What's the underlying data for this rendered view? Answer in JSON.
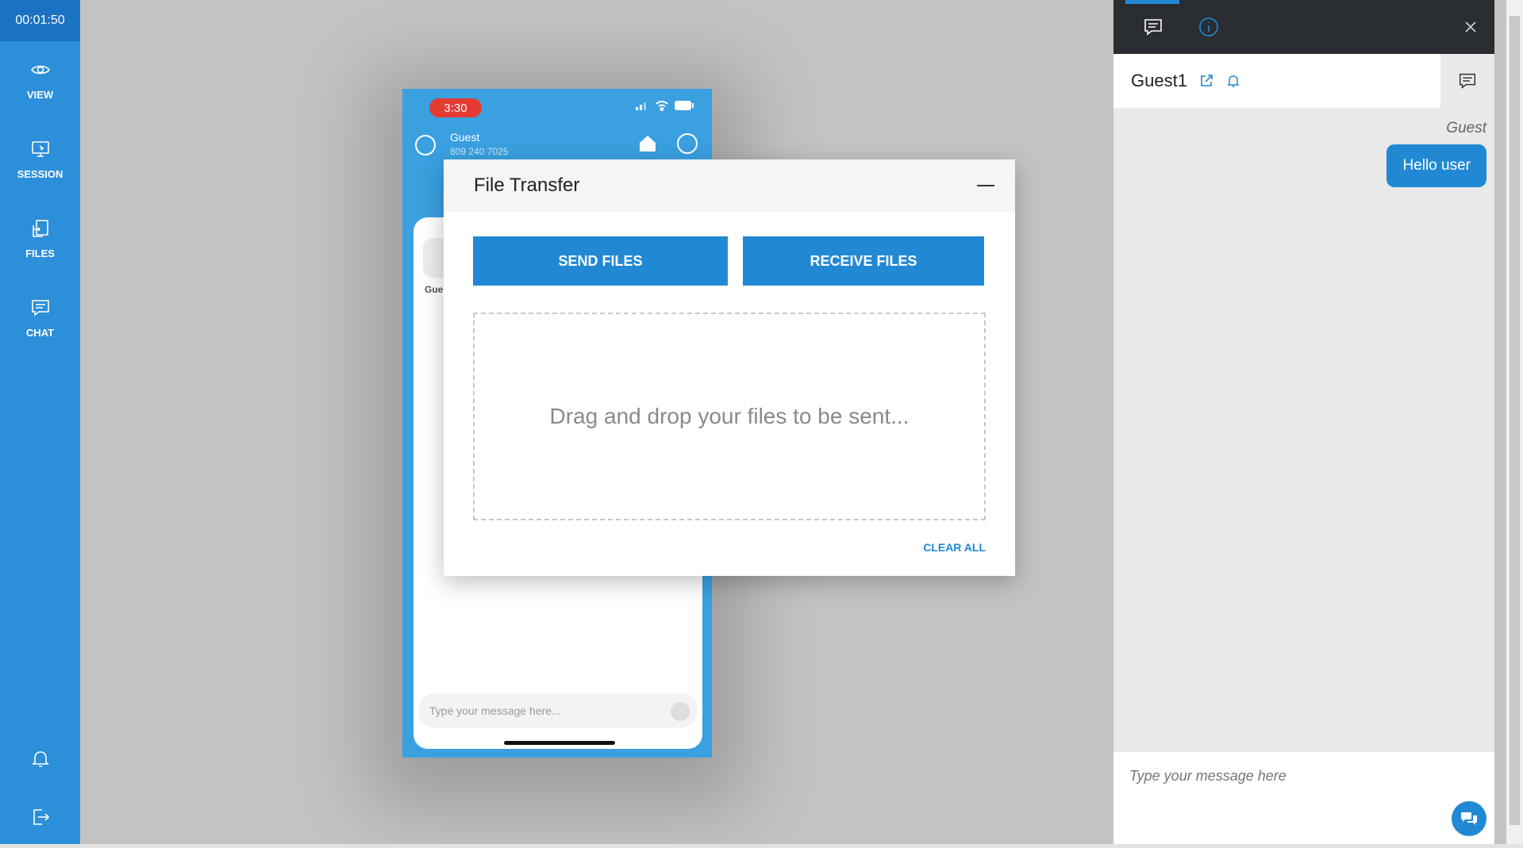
{
  "sidebar": {
    "timer": "00:01:50",
    "items": [
      {
        "label": "VIEW",
        "icon": "eye-icon"
      },
      {
        "label": "SESSION",
        "icon": "monitor-icon"
      },
      {
        "label": "FILES",
        "icon": "file-transfer-icon"
      },
      {
        "label": "CHAT",
        "icon": "chat-icon"
      }
    ],
    "bottom_icons": [
      "bell-icon",
      "logout-icon"
    ]
  },
  "phone": {
    "time": "3:30",
    "guest_name": "Guest",
    "guest_phone": "809 240 7025",
    "partial_label": "Gue",
    "input_placeholder": "Type your message here..."
  },
  "dialog": {
    "title": "File Transfer",
    "send_label": "SEND FILES",
    "receive_label": "RECEIVE FILES",
    "dropzone_text": "Drag and drop your files to be sent...",
    "clear_label": "CLEAR ALL"
  },
  "chat": {
    "guest_title": "Guest1",
    "messages": [
      {
        "sender": "Guest",
        "text": "Hello user"
      }
    ],
    "input_placeholder": "Type your message here"
  },
  "colors": {
    "accent": "#2189d4",
    "sidebar": "#2c8fd9",
    "timer_bg": "#1b72c2",
    "chat_topbar": "#2a2d31"
  }
}
